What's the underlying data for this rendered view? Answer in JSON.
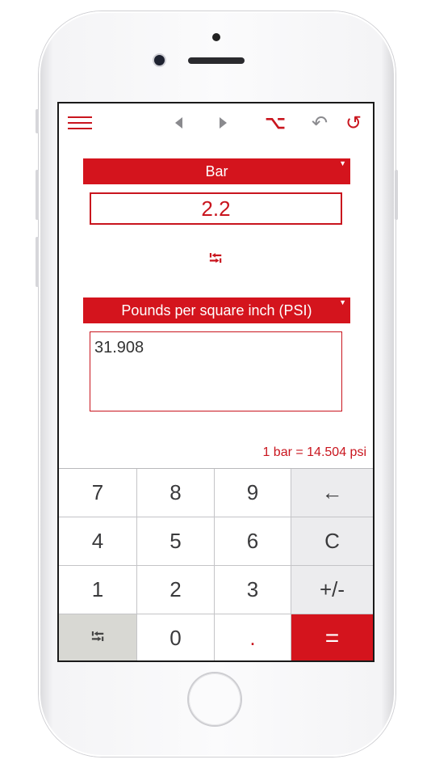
{
  "toolbar": {
    "menu_icon": "menu-icon",
    "back_icon": "triangle-left-icon",
    "forward_icon": "triangle-right-icon",
    "option_glyph": "⌥",
    "undo_glyph": "↶",
    "reset_glyph": "↺"
  },
  "from": {
    "unit": "Bar",
    "value": "2.2"
  },
  "swap_glyph": "⭾",
  "to": {
    "unit": "Pounds per square inch (PSI)",
    "value": "31.908"
  },
  "factor_text": "1 bar = 14.504 psi",
  "keypad": {
    "k7": "7",
    "k8": "8",
    "k9": "9",
    "backspace": "←",
    "k4": "4",
    "k5": "5",
    "k6": "6",
    "clear": "C",
    "k1": "1",
    "k2": "2",
    "k3": "3",
    "sign": "+/-",
    "swap": "⭾",
    "k0": "0",
    "dot": ".",
    "equals": "="
  },
  "colors": {
    "accent": "#d4141d",
    "key_bg": "#ffffff",
    "op_key_bg": "#ececee",
    "swap_key_bg": "#d8d8d3"
  }
}
